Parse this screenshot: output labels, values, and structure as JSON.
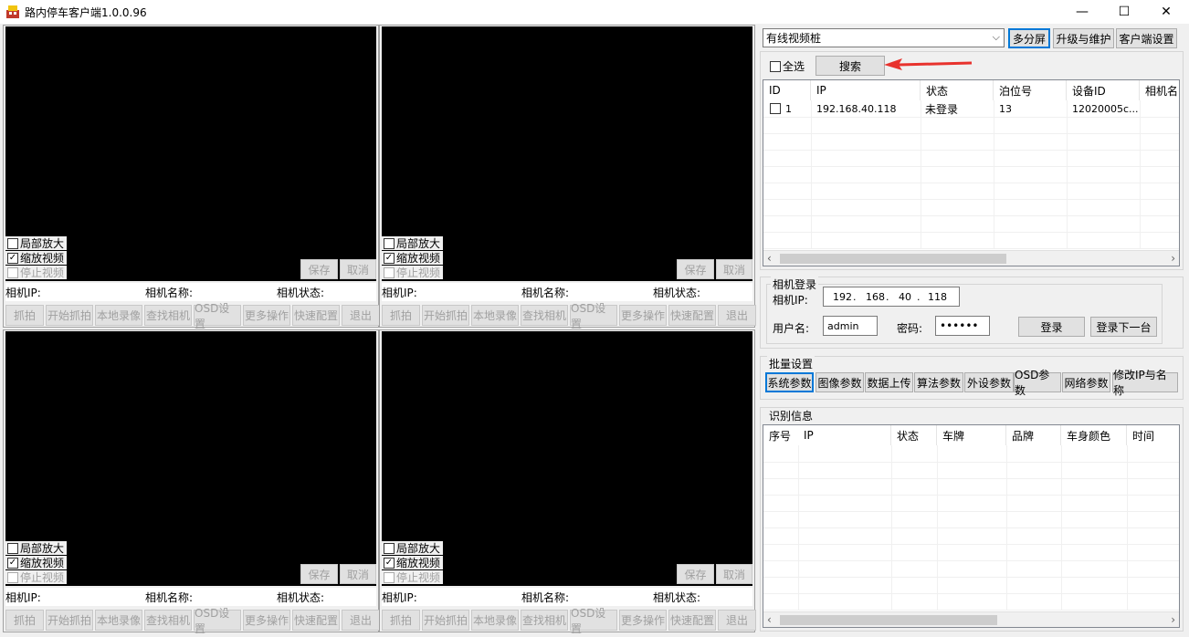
{
  "window": {
    "title": "路内停车客户端1.0.0.96",
    "min": "—",
    "max": "☐",
    "close": "✕"
  },
  "video": {
    "zoom_label": "局部放大",
    "scale_label": "缩放视频",
    "stop_label": "停止视频",
    "save": "保存",
    "cancel": "取消",
    "ip_label": "相机IP:",
    "name_label": "相机名称:",
    "status_label": "相机状态:",
    "tools": [
      "抓拍",
      "开始抓拍",
      "本地录像",
      "查找相机",
      "OSD设置",
      "更多操作",
      "快速配置",
      "退出"
    ]
  },
  "right": {
    "device_type": "有线视频桩",
    "multi_screen": "多分屏",
    "upgrade": "升级与维护",
    "client_settings": "客户端设置",
    "select_all": "全选",
    "search": "搜索",
    "device_table": {
      "headers": [
        "ID",
        "IP",
        "状态",
        "泊位号",
        "设备ID",
        "相机名"
      ],
      "rows": [
        {
          "id": "1",
          "ip": "192.168.40.118",
          "status": "未登录",
          "berth": "13",
          "device_id": "12020005c..."
        }
      ]
    },
    "login": {
      "title": "相机登录",
      "ip_label": "相机IP:",
      "ip": [
        "192",
        "168",
        "40",
        "118"
      ],
      "user_label": "用户名:",
      "user": "admin",
      "pwd_label": "密码:",
      "pwd": "••••••",
      "login_btn": "登录",
      "login_next_btn": "登录下一台"
    },
    "batch": {
      "title": "批量设置",
      "buttons": [
        "系统参数",
        "图像参数",
        "数据上传",
        "算法参数",
        "外设参数",
        "OSD参数",
        "网络参数",
        "修改IP与名称"
      ]
    },
    "recognition": {
      "title": "识别信息",
      "headers": [
        "序号",
        "IP",
        "状态",
        "车牌",
        "品牌",
        "车身颜色",
        "时间"
      ]
    }
  }
}
